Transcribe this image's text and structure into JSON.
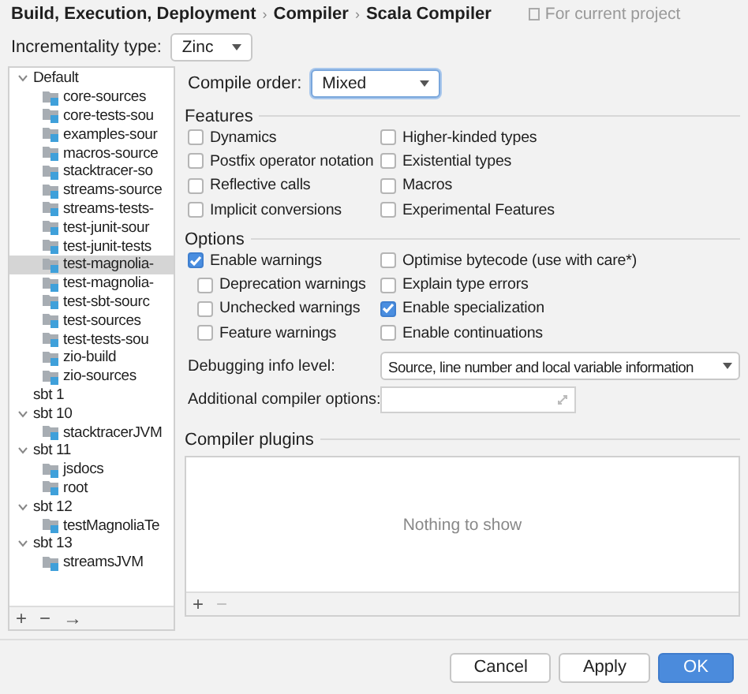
{
  "breadcrumb": {
    "parts": [
      "Build, Execution, Deployment",
      "Compiler",
      "Scala Compiler"
    ],
    "separator": "›",
    "scope": "For current project"
  },
  "incrementality": {
    "label": "Incrementality type:",
    "value": "Zinc"
  },
  "tree": [
    {
      "label": "Default",
      "expanded": true,
      "selected": false,
      "children": [
        {
          "label": "core-sources",
          "selected": false
        },
        {
          "label": "core-tests-sou",
          "selected": false
        },
        {
          "label": "examples-sour",
          "selected": false
        },
        {
          "label": "macros-source",
          "selected": false
        },
        {
          "label": "stacktracer-so",
          "selected": false
        },
        {
          "label": "streams-source",
          "selected": false
        },
        {
          "label": "streams-tests-",
          "selected": false
        },
        {
          "label": "test-junit-sour",
          "selected": false
        },
        {
          "label": "test-junit-tests",
          "selected": false
        },
        {
          "label": "test-magnolia-",
          "selected": true
        },
        {
          "label": "test-magnolia-",
          "selected": false
        },
        {
          "label": "test-sbt-sourc",
          "selected": false
        },
        {
          "label": "test-sources",
          "selected": false
        },
        {
          "label": "test-tests-sou",
          "selected": false
        },
        {
          "label": "zio-build",
          "selected": false
        },
        {
          "label": "zio-sources",
          "selected": false
        }
      ]
    },
    {
      "label": "sbt 1",
      "selected": false
    },
    {
      "label": "sbt 10",
      "expanded": true,
      "selected": false,
      "children": [
        {
          "label": "stacktracerJVM",
          "selected": false
        }
      ]
    },
    {
      "label": "sbt 11",
      "expanded": true,
      "selected": false,
      "children": [
        {
          "label": "jsdocs",
          "selected": false
        },
        {
          "label": "root",
          "selected": false
        }
      ]
    },
    {
      "label": "sbt 12",
      "expanded": true,
      "selected": false,
      "children": [
        {
          "label": "testMagnoliaTe",
          "selected": false
        }
      ]
    },
    {
      "label": "sbt 13",
      "expanded": true,
      "selected": false,
      "children": [
        {
          "label": "streamsJVM",
          "selected": false
        }
      ]
    }
  ],
  "tree_toolbar": [
    "+",
    "−",
    "→"
  ],
  "compile_order": {
    "label": "Compile order:",
    "value": "Mixed"
  },
  "features": {
    "title": "Features",
    "left": [
      {
        "label": "Dynamics",
        "checked": false
      },
      {
        "label": "Postfix operator notation",
        "checked": false
      },
      {
        "label": "Reflective calls",
        "checked": false
      },
      {
        "label": "Implicit conversions",
        "checked": false
      }
    ],
    "right": [
      {
        "label": "Higher-kinded types",
        "checked": false
      },
      {
        "label": "Existential types",
        "checked": false
      },
      {
        "label": "Macros",
        "checked": false
      },
      {
        "label": "Experimental Features",
        "checked": false
      }
    ]
  },
  "options": {
    "title": "Options",
    "left": [
      {
        "label": "Enable warnings",
        "checked": true,
        "kind": "main"
      },
      {
        "label": "Deprecation warnings",
        "checked": false,
        "kind": "sub"
      },
      {
        "label": "Unchecked warnings",
        "checked": false,
        "kind": "sub"
      },
      {
        "label": "Feature warnings",
        "checked": false,
        "kind": "sub"
      }
    ],
    "right": [
      {
        "label": "Optimise bytecode (use with care*)",
        "checked": false
      },
      {
        "label": "Explain type errors",
        "checked": false
      },
      {
        "label": "Enable specialization",
        "checked": true
      },
      {
        "label": "Enable continuations",
        "checked": false
      }
    ]
  },
  "debugging": {
    "label": "Debugging info level:",
    "value": "Source, line number and local variable information"
  },
  "additional": {
    "label": "Additional compiler options:"
  },
  "plugins": {
    "title": "Compiler plugins",
    "empty_text": "Nothing to show",
    "toolbar": [
      {
        "label": "+",
        "disabled": false
      },
      {
        "label": "−",
        "disabled": true
      }
    ]
  },
  "buttons": [
    {
      "label": "Cancel",
      "primary": false
    },
    {
      "label": "Apply",
      "primary": false
    },
    {
      "label": "OK",
      "primary": true
    }
  ]
}
